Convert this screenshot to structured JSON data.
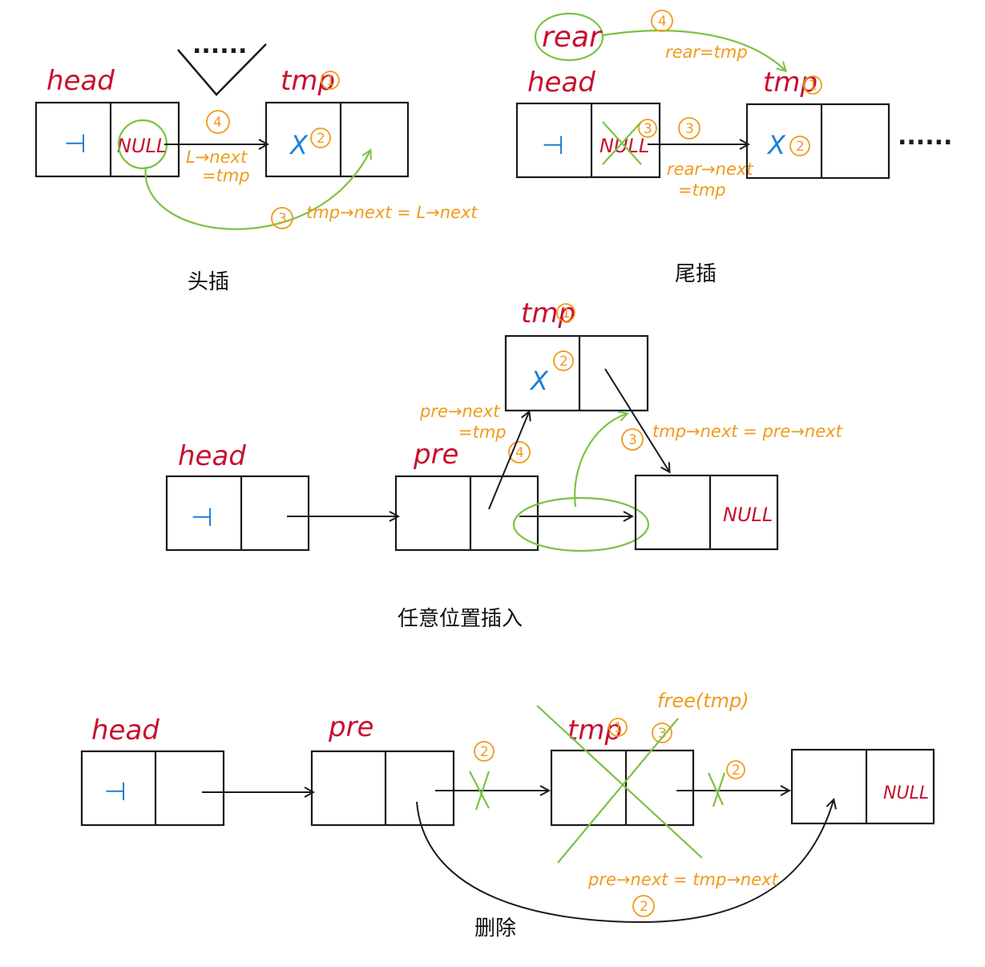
{
  "colors": {
    "label": "#c8102e",
    "value": "#1e7fd6",
    "annotation": "#f09a1a",
    "highlight": "#7cc242",
    "ink": "#1a1a1a"
  },
  "head_insert": {
    "caption": "头插",
    "head": "head",
    "tmp": "tmp",
    "head_val": "⊣",
    "head_next": "NULL",
    "tmp_val": "X",
    "dots": "......",
    "step1": "1",
    "step2": "2",
    "step3": "3",
    "step4": "4",
    "ann_l_next_1": "L→next",
    "ann_l_next_2": "=tmp",
    "ann_tmp_next": "tmp→next = L→next"
  },
  "tail_insert": {
    "caption": "尾插",
    "rear": "rear",
    "head": "head",
    "tmp": "tmp",
    "head_val": "⊣",
    "head_next": "NULL",
    "tmp_val": "X",
    "dots": "......",
    "step1": "1",
    "step2": "2",
    "step3a": "3",
    "step3b": "3",
    "step4": "4",
    "ann_rear_tmp": "rear=tmp",
    "ann_rear_next_1": "rear→next",
    "ann_rear_next_2": "=tmp"
  },
  "any_insert": {
    "caption": "任意位置插入",
    "head": "head",
    "pre": "pre",
    "tmp": "tmp",
    "head_val": "⊣",
    "tmp_val": "X",
    "last_next": "NULL",
    "step1": "1",
    "step2": "2",
    "step3": "3",
    "step4": "4",
    "ann_pre_next_1": "pre→next",
    "ann_pre_next_2": "=tmp",
    "ann_tmp_next": "tmp→next = pre→next"
  },
  "delete": {
    "caption": "删除",
    "head": "head",
    "pre": "pre",
    "tmp": "tmp",
    "head_val": "⊣",
    "last_next": "NULL",
    "step1": "1",
    "step2a": "2",
    "step2b": "2",
    "step2c": "2",
    "step3": "3",
    "ann_free": "free(tmp)",
    "ann_pre_next": "pre→next = tmp→next"
  }
}
